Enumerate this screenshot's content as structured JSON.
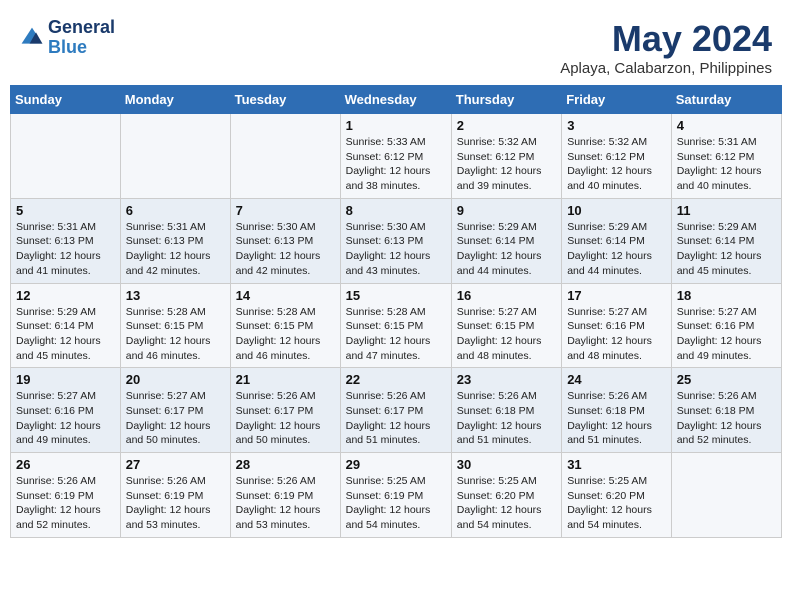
{
  "logo": {
    "line1": "General",
    "line2": "Blue"
  },
  "title": "May 2024",
  "subtitle": "Aplaya, Calabarzon, Philippines",
  "days_header": [
    "Sunday",
    "Monday",
    "Tuesday",
    "Wednesday",
    "Thursday",
    "Friday",
    "Saturday"
  ],
  "weeks": [
    [
      {
        "day": "",
        "sunrise": "",
        "sunset": "",
        "daylight": ""
      },
      {
        "day": "",
        "sunrise": "",
        "sunset": "",
        "daylight": ""
      },
      {
        "day": "",
        "sunrise": "",
        "sunset": "",
        "daylight": ""
      },
      {
        "day": "1",
        "sunrise": "Sunrise: 5:33 AM",
        "sunset": "Sunset: 6:12 PM",
        "daylight": "Daylight: 12 hours and 38 minutes."
      },
      {
        "day": "2",
        "sunrise": "Sunrise: 5:32 AM",
        "sunset": "Sunset: 6:12 PM",
        "daylight": "Daylight: 12 hours and 39 minutes."
      },
      {
        "day": "3",
        "sunrise": "Sunrise: 5:32 AM",
        "sunset": "Sunset: 6:12 PM",
        "daylight": "Daylight: 12 hours and 40 minutes."
      },
      {
        "day": "4",
        "sunrise": "Sunrise: 5:31 AM",
        "sunset": "Sunset: 6:12 PM",
        "daylight": "Daylight: 12 hours and 40 minutes."
      }
    ],
    [
      {
        "day": "5",
        "sunrise": "Sunrise: 5:31 AM",
        "sunset": "Sunset: 6:13 PM",
        "daylight": "Daylight: 12 hours and 41 minutes."
      },
      {
        "day": "6",
        "sunrise": "Sunrise: 5:31 AM",
        "sunset": "Sunset: 6:13 PM",
        "daylight": "Daylight: 12 hours and 42 minutes."
      },
      {
        "day": "7",
        "sunrise": "Sunrise: 5:30 AM",
        "sunset": "Sunset: 6:13 PM",
        "daylight": "Daylight: 12 hours and 42 minutes."
      },
      {
        "day": "8",
        "sunrise": "Sunrise: 5:30 AM",
        "sunset": "Sunset: 6:13 PM",
        "daylight": "Daylight: 12 hours and 43 minutes."
      },
      {
        "day": "9",
        "sunrise": "Sunrise: 5:29 AM",
        "sunset": "Sunset: 6:14 PM",
        "daylight": "Daylight: 12 hours and 44 minutes."
      },
      {
        "day": "10",
        "sunrise": "Sunrise: 5:29 AM",
        "sunset": "Sunset: 6:14 PM",
        "daylight": "Daylight: 12 hours and 44 minutes."
      },
      {
        "day": "11",
        "sunrise": "Sunrise: 5:29 AM",
        "sunset": "Sunset: 6:14 PM",
        "daylight": "Daylight: 12 hours and 45 minutes."
      }
    ],
    [
      {
        "day": "12",
        "sunrise": "Sunrise: 5:29 AM",
        "sunset": "Sunset: 6:14 PM",
        "daylight": "Daylight: 12 hours and 45 minutes."
      },
      {
        "day": "13",
        "sunrise": "Sunrise: 5:28 AM",
        "sunset": "Sunset: 6:15 PM",
        "daylight": "Daylight: 12 hours and 46 minutes."
      },
      {
        "day": "14",
        "sunrise": "Sunrise: 5:28 AM",
        "sunset": "Sunset: 6:15 PM",
        "daylight": "Daylight: 12 hours and 46 minutes."
      },
      {
        "day": "15",
        "sunrise": "Sunrise: 5:28 AM",
        "sunset": "Sunset: 6:15 PM",
        "daylight": "Daylight: 12 hours and 47 minutes."
      },
      {
        "day": "16",
        "sunrise": "Sunrise: 5:27 AM",
        "sunset": "Sunset: 6:15 PM",
        "daylight": "Daylight: 12 hours and 48 minutes."
      },
      {
        "day": "17",
        "sunrise": "Sunrise: 5:27 AM",
        "sunset": "Sunset: 6:16 PM",
        "daylight": "Daylight: 12 hours and 48 minutes."
      },
      {
        "day": "18",
        "sunrise": "Sunrise: 5:27 AM",
        "sunset": "Sunset: 6:16 PM",
        "daylight": "Daylight: 12 hours and 49 minutes."
      }
    ],
    [
      {
        "day": "19",
        "sunrise": "Sunrise: 5:27 AM",
        "sunset": "Sunset: 6:16 PM",
        "daylight": "Daylight: 12 hours and 49 minutes."
      },
      {
        "day": "20",
        "sunrise": "Sunrise: 5:27 AM",
        "sunset": "Sunset: 6:17 PM",
        "daylight": "Daylight: 12 hours and 50 minutes."
      },
      {
        "day": "21",
        "sunrise": "Sunrise: 5:26 AM",
        "sunset": "Sunset: 6:17 PM",
        "daylight": "Daylight: 12 hours and 50 minutes."
      },
      {
        "day": "22",
        "sunrise": "Sunrise: 5:26 AM",
        "sunset": "Sunset: 6:17 PM",
        "daylight": "Daylight: 12 hours and 51 minutes."
      },
      {
        "day": "23",
        "sunrise": "Sunrise: 5:26 AM",
        "sunset": "Sunset: 6:18 PM",
        "daylight": "Daylight: 12 hours and 51 minutes."
      },
      {
        "day": "24",
        "sunrise": "Sunrise: 5:26 AM",
        "sunset": "Sunset: 6:18 PM",
        "daylight": "Daylight: 12 hours and 51 minutes."
      },
      {
        "day": "25",
        "sunrise": "Sunrise: 5:26 AM",
        "sunset": "Sunset: 6:18 PM",
        "daylight": "Daylight: 12 hours and 52 minutes."
      }
    ],
    [
      {
        "day": "26",
        "sunrise": "Sunrise: 5:26 AM",
        "sunset": "Sunset: 6:19 PM",
        "daylight": "Daylight: 12 hours and 52 minutes."
      },
      {
        "day": "27",
        "sunrise": "Sunrise: 5:26 AM",
        "sunset": "Sunset: 6:19 PM",
        "daylight": "Daylight: 12 hours and 53 minutes."
      },
      {
        "day": "28",
        "sunrise": "Sunrise: 5:26 AM",
        "sunset": "Sunset: 6:19 PM",
        "daylight": "Daylight: 12 hours and 53 minutes."
      },
      {
        "day": "29",
        "sunrise": "Sunrise: 5:25 AM",
        "sunset": "Sunset: 6:19 PM",
        "daylight": "Daylight: 12 hours and 54 minutes."
      },
      {
        "day": "30",
        "sunrise": "Sunrise: 5:25 AM",
        "sunset": "Sunset: 6:20 PM",
        "daylight": "Daylight: 12 hours and 54 minutes."
      },
      {
        "day": "31",
        "sunrise": "Sunrise: 5:25 AM",
        "sunset": "Sunset: 6:20 PM",
        "daylight": "Daylight: 12 hours and 54 minutes."
      },
      {
        "day": "",
        "sunrise": "",
        "sunset": "",
        "daylight": ""
      }
    ]
  ]
}
